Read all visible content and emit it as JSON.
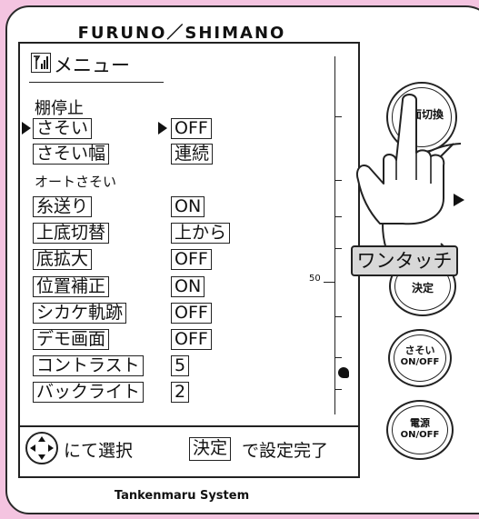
{
  "brand": {
    "title": "FURUNO／SHIMANO",
    "footer": "Tankenmaru System"
  },
  "screen": {
    "menu_title": "メニュー",
    "items": [
      {
        "label": "棚停止",
        "value": null,
        "boxed": false,
        "selected": false
      },
      {
        "label": "さそい",
        "value": "OFF",
        "boxed": true,
        "selected": true
      },
      {
        "label": "さそい幅",
        "value": "連続",
        "boxed": true,
        "selected": false
      },
      {
        "label": "オートさそい",
        "value": null,
        "boxed": false,
        "selected": false
      },
      {
        "label": "糸送り",
        "value": "ON",
        "boxed": true,
        "selected": false
      },
      {
        "label": "上底切替",
        "value": "上から",
        "boxed": true,
        "selected": false
      },
      {
        "label": "底拡大",
        "value": "OFF",
        "boxed": true,
        "selected": false
      },
      {
        "label": "位置補正",
        "value": "ON",
        "boxed": true,
        "selected": false
      },
      {
        "label": "シカケ軌跡",
        "value": "OFF",
        "boxed": true,
        "selected": false
      },
      {
        "label": "デモ画面",
        "value": "OFF",
        "boxed": true,
        "selected": false
      },
      {
        "label": "コントラスト",
        "value": "5",
        "boxed": true,
        "selected": false
      },
      {
        "label": "バックライト",
        "value": "2",
        "boxed": true,
        "selected": false
      }
    ],
    "scale_label": "50",
    "footer_select": "にて選択",
    "footer_confirm_key": "決定",
    "footer_confirm_text": "で設定完了"
  },
  "buttons": {
    "screen_switch": "画面切換",
    "confirm": "決定",
    "sasoi": "さそい",
    "sasoi_sub": "ON/OFF",
    "power": "電源",
    "power_sub": "ON/OFF"
  },
  "callout": "ワンタッチ",
  "colors": {
    "background": "#f4c4e0",
    "callout_bg": "#d8d8d8"
  }
}
